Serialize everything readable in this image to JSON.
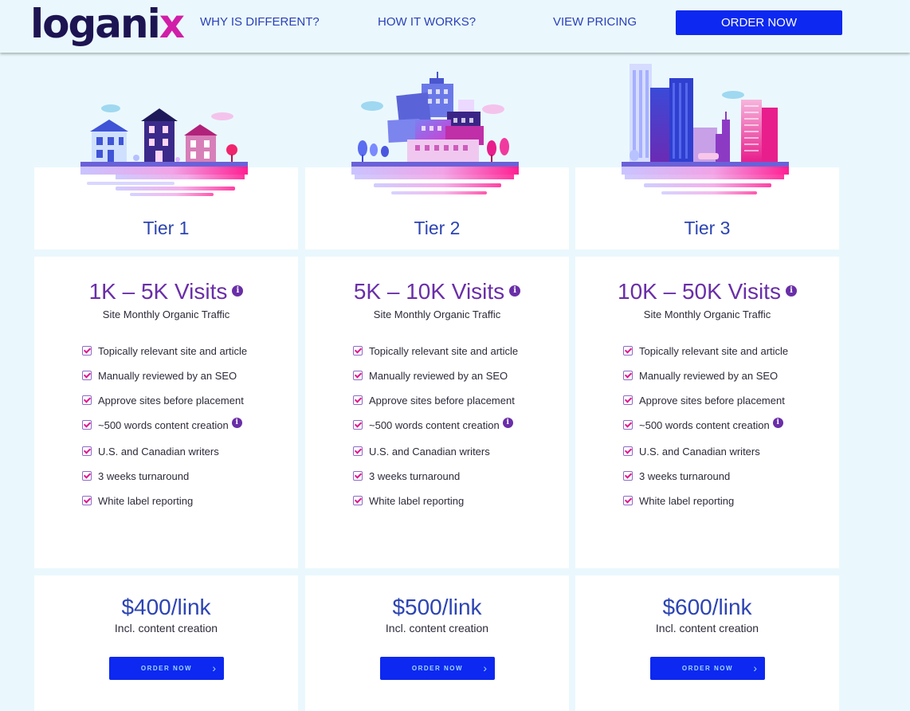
{
  "header": {
    "logo_main": "logani",
    "logo_accent": "x",
    "nav": [
      {
        "label": "WHY IS DIFFERENT?"
      },
      {
        "label": "HOW IT WORKS?"
      },
      {
        "label": "VIEW PRICING"
      }
    ],
    "order_label": "ORDER NOW"
  },
  "tiers": [
    {
      "name": "Tier 1",
      "visits": "1K – 5K Visits",
      "visits_sub": "Site Monthly Organic Traffic",
      "features": [
        "Topically relevant site and article",
        "Manually reviewed by an SEO",
        "Approve sites before placement",
        "~500 words content creation",
        "U.S. and Canadian writers",
        "3 weeks turnaround",
        "White label reporting"
      ],
      "price": "$400/link",
      "price_sub": "Incl. content creation",
      "order_label": "ORDER NOW"
    },
    {
      "name": "Tier 2",
      "visits": "5K – 10K Visits",
      "visits_sub": "Site Monthly Organic Traffic",
      "features": [
        "Topically relevant site and article",
        "Manually reviewed by an SEO",
        "Approve sites before placement",
        "~500 words content creation",
        "U.S. and Canadian writers",
        "3 weeks turnaround",
        "White label reporting"
      ],
      "price": "$500/link",
      "price_sub": "Incl. content creation",
      "order_label": "ORDER NOW"
    },
    {
      "name": "Tier 3",
      "visits": "10K – 50K Visits",
      "visits_sub": "Site Monthly Organic Traffic",
      "features": [
        "Topically relevant site and article",
        "Manually reviewed by an SEO",
        "Approve sites before placement",
        "~500 words content creation",
        "U.S. and Canadian writers",
        "3 weeks turnaround",
        "White label reporting"
      ],
      "price": "$600/link",
      "price_sub": "Incl. content creation",
      "order_label": "ORDER NOW"
    }
  ],
  "icons": {
    "info": "info-icon",
    "check": "checkbox-check-icon",
    "chevron": "chevron-right-icon"
  },
  "colors": {
    "brand_blue": "#0d28f0",
    "tier_blue": "#2c44b3",
    "visits_purple": "#6a2ea8",
    "accent_pink": "#e2188f",
    "page_bg": "#eaf8fd"
  }
}
